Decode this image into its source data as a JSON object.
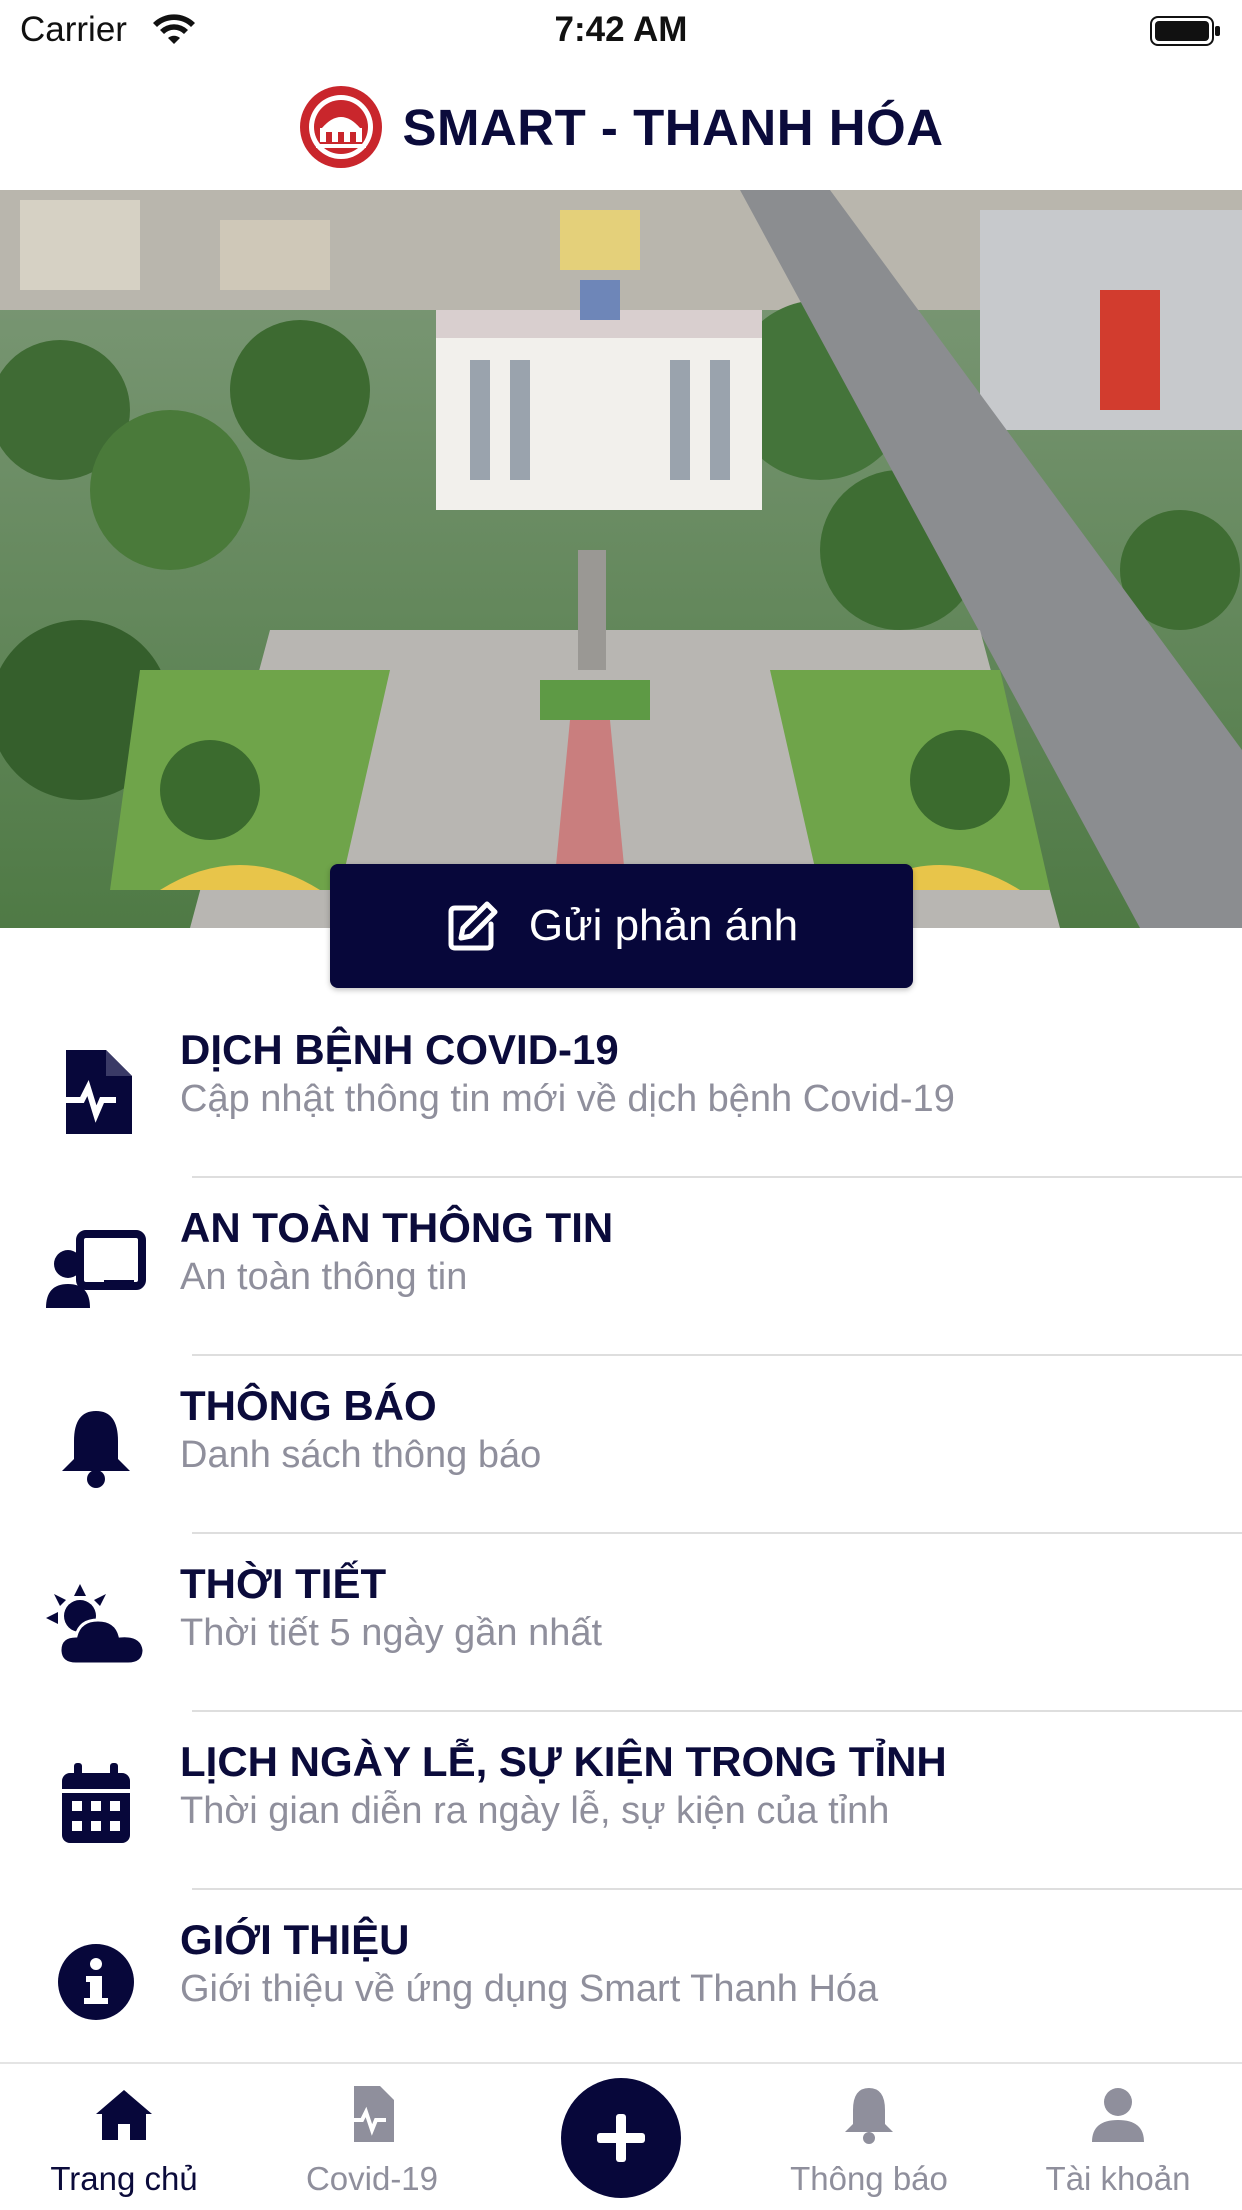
{
  "status_bar": {
    "carrier": "Carrier",
    "time": "7:42 AM"
  },
  "header": {
    "title": "SMART - THANH HÓA",
    "logo_icon": "thanh-hoa-emblem-icon"
  },
  "report_button": {
    "label": "Gửi phản ánh",
    "icon": "edit-icon"
  },
  "menu": {
    "items": [
      {
        "title": "DỊCH BỆNH COVID-19",
        "subtitle": "Cập nhật thông tin mới về dịch bệnh Covid-19",
        "icon": "medical-file-icon"
      },
      {
        "title": "AN TOÀN THÔNG TIN",
        "subtitle": "An toàn thông tin",
        "icon": "user-screen-icon"
      },
      {
        "title": "THÔNG BÁO",
        "subtitle": "Danh sách thông báo",
        "icon": "bell-icon"
      },
      {
        "title": "THỜI TIẾT",
        "subtitle": "Thời tiết 5 ngày gần nhất",
        "icon": "weather-icon"
      },
      {
        "title": "LỊCH NGÀY LỄ, SỰ KIỆN TRONG TỈNH",
        "subtitle": "Thời gian diễn ra ngày lễ, sự kiện của tỉnh",
        "icon": "calendar-icon"
      },
      {
        "title": "GIỚI THIỆU",
        "subtitle": "Giới thiệu về ứng dụng Smart Thanh Hóa",
        "icon": "info-icon"
      }
    ]
  },
  "tabbar": {
    "tabs": [
      {
        "label": "Trang chủ",
        "icon": "home-icon",
        "active": true
      },
      {
        "label": "Covid-19",
        "icon": "medical-file-icon",
        "active": false
      },
      {
        "label": "",
        "icon": "plus-icon",
        "active": false
      },
      {
        "label": "Thông báo",
        "icon": "bell-icon",
        "active": false
      },
      {
        "label": "Tài khoản",
        "icon": "user-icon",
        "active": false
      }
    ]
  },
  "colors": {
    "primary": "#07073a",
    "subtitle": "#8f8f9c",
    "separator": "#dedede",
    "inactive_tab": "#8f8f9c"
  }
}
